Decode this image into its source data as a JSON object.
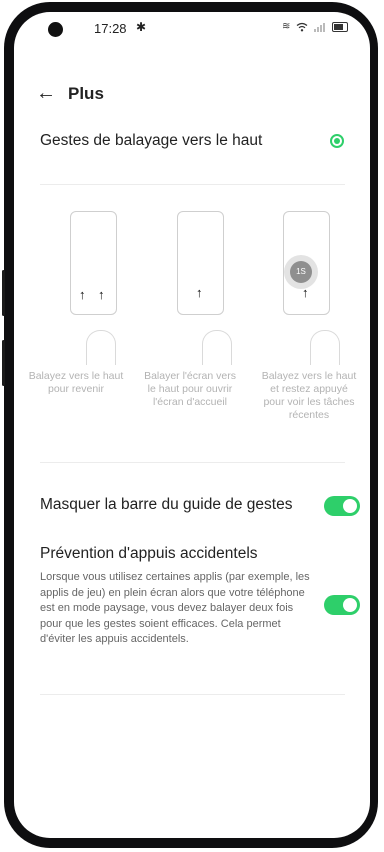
{
  "status_bar": {
    "time": "17:28",
    "icons": [
      "camera-icon",
      "gear-icon",
      "vibrate-icon",
      "wifi-icon",
      "signal-icon",
      "battery-icon"
    ]
  },
  "header": {
    "title": "Plus"
  },
  "gestures_option": {
    "label": "Gestes de balayage vers le haut",
    "selected": true
  },
  "illustrations": [
    {
      "caption": "Balayez vers le haut\npour revenir"
    },
    {
      "caption": "Balayer l'écran vers\nle haut pour ouvrir\nl'écran d'accueil"
    },
    {
      "caption": "Balayez vers le haut\net restez appuyé\npour voir les tâches\nrécentes",
      "hold_label": "1S"
    }
  ],
  "settings": {
    "hide_bar": {
      "label": "Masquer la barre du guide de gestes",
      "enabled": true
    },
    "prevent": {
      "label": "Prévention d'appuis accidentels",
      "description": "Lorsque vous utilisez certaines applis (par exemple, les applis de jeu) en plein écran alors que votre téléphone est en mode paysage, vous devez balayer deux fois pour que les gestes soient efficaces. Cela permet d'éviter les appuis accidentels.",
      "enabled": true
    }
  },
  "colors": {
    "accent": "#2ecf6a",
    "frame": "#0e0e10"
  }
}
